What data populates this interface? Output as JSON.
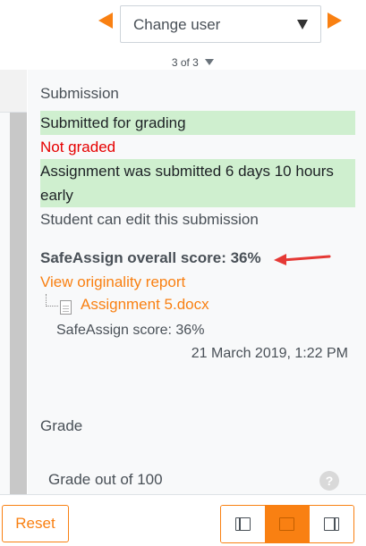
{
  "navigation": {
    "user_select_label": "Change user",
    "counter": "3 of 3"
  },
  "submission": {
    "section_title": "Submission",
    "status_submitted": "Submitted for grading",
    "status_grading": "Not graded",
    "timing_line1": "Assignment was submitted 6 days 10 hours",
    "timing_line2": "early",
    "edit_status": "Student can edit this submission"
  },
  "safeassign": {
    "overall_score_label": "SafeAssign overall score: 36%",
    "report_link": "View originality report",
    "file_name": "Assignment 5.docx",
    "file_score": "SafeAssign score: 36%",
    "file_date": "21 March 2019, 1:22 PM"
  },
  "grade": {
    "section_title": "Grade",
    "grade_out_of": "Grade out of 100",
    "help_icon": "?"
  },
  "footer": {
    "reset_label": "Reset",
    "layout_options": [
      "collapse-grade-panel-icon",
      "split-view-icon",
      "collapse-review-panel-icon"
    ],
    "active_layout": "split-view-icon"
  },
  "colors": {
    "accent": "#f98012",
    "success_bg": "#cfefcf",
    "error_text": "#e60000",
    "annotation_arrow": "#e53935"
  }
}
